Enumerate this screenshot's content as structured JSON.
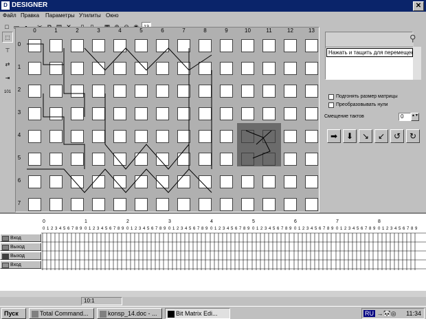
{
  "window": {
    "title": "DESIGNER",
    "app_icon": "D"
  },
  "menu": [
    "Файл",
    "Правка",
    "Параметры",
    "Утилиты",
    "Окно"
  ],
  "toolbar": {
    "zoom_value": "13"
  },
  "matrix": {
    "columns": [
      "0",
      "1",
      "2",
      "3",
      "4",
      "5",
      "6",
      "7",
      "8",
      "9",
      "10",
      "11",
      "12",
      "13"
    ],
    "rows": [
      "0",
      "1",
      "2",
      "3",
      "4",
      "5",
      "6",
      "7"
    ]
  },
  "right_panel": {
    "hint": "Нажать и тащить для перемещения",
    "checkbox_fit": "Подгонять размер матрицы",
    "checkbox_zero": "Преобразовывать нули",
    "shift_label": "Смещение тактов",
    "shift_value": "0"
  },
  "timing": {
    "major_ticks": [
      "0",
      "1",
      "2",
      "3",
      "4",
      "5",
      "6",
      "7",
      "8"
    ],
    "minor_ticks": [
      "0",
      "1",
      "2",
      "3",
      "4",
      "5",
      "6",
      "7",
      "8",
      "9"
    ],
    "signals": [
      {
        "name": "Вход",
        "color": "#808080"
      },
      {
        "name": "Выход",
        "color": "#808080"
      },
      {
        "name": "Выход",
        "color": "#404040"
      },
      {
        "name": "Вход",
        "color": "#909090"
      }
    ]
  },
  "status": {
    "ratio": "10:1"
  },
  "taskbar": {
    "start": "Пуск",
    "tasks": [
      "Total Command...",
      "konsp_14.doc - ...",
      "Bit Matrix Edi..."
    ],
    "lang": "RU",
    "clock": "11:34"
  }
}
